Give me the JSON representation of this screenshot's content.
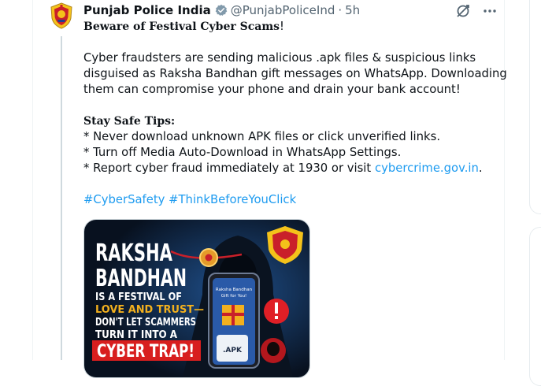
{
  "tweet": {
    "author_name": "Punjab Police India",
    "handle": "@PunjabPoliceInd",
    "separator": "·",
    "time": "5h",
    "title": "Beware of Festival Cyber Scams",
    "title_end": "!",
    "para1": [
      "Cyber fraudsters are sending malicious .apk files & suspicious links",
      "disguised as Raksha Bandhan gift messages on WhatsApp. Downloading",
      "them can compromise your phone and drain your bank account!"
    ],
    "tips_heading": "Stay Safe Tips:",
    "tips": [
      "* Never download unknown APK files or click unverified links.",
      "* Turn off Media Auto-Download in WhatsApp Settings."
    ],
    "tip3_prefix": "* Report cyber fraud immediately at 1930 or visit ",
    "tip3_link": "cybercrime.gov.in",
    "tip3_suffix": ".",
    "hashtags": [
      "#CyberSafety",
      "#ThinkBeforeYouClick"
    ]
  },
  "media": {
    "headline": [
      "RAKSHA",
      "BANDHAN"
    ],
    "sub": [
      "IS A FESTIVAL OF",
      "LOVE AND TRUST—",
      "DON'T LET SCAMMERS",
      "TURN IT INTO A"
    ],
    "trap": "CYBER TRAP!",
    "phone_text": [
      "Raksha Bandhan",
      "Gift for You!"
    ],
    "apk_label": ".APK"
  },
  "colors": {
    "link": "#1d9bf0",
    "verified": "#829aab",
    "muted": "#536471",
    "media_bg": "#0d1a2e",
    "trap_red": "#d81e1e"
  }
}
